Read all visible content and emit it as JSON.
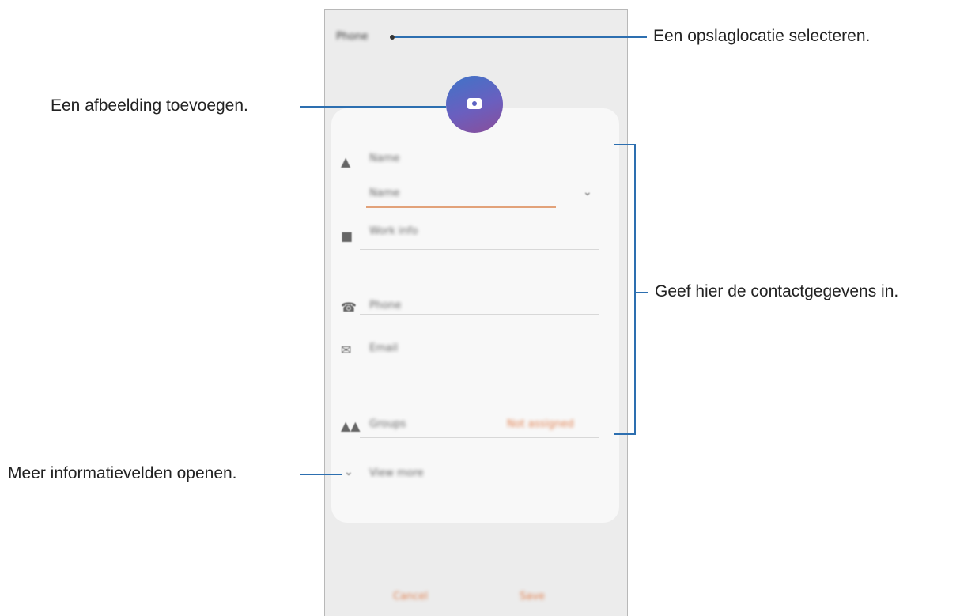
{
  "phone": {
    "storage_label": "Phone",
    "name_label": "Name",
    "name_field": "Name",
    "work_info": "Work info",
    "phone_field": "Phone",
    "email_field": "Email",
    "groups_label": "Groups",
    "label_selector": "Not assigned",
    "view_more": "View more",
    "cancel_label": "Cancel",
    "save_label": "Save"
  },
  "callouts": {
    "storage": "Een opslaglocatie selecteren.",
    "picture": "Een afbeelding toevoegen.",
    "contact_info": "Geef hier de contactgegevens in.",
    "more_fields": "Meer informatievelden openen."
  },
  "colors": {
    "leader_line": "#2d6fb0",
    "accent": "#e08050",
    "avatar_start": "#3f74c8",
    "avatar_end": "#8a4e99"
  }
}
